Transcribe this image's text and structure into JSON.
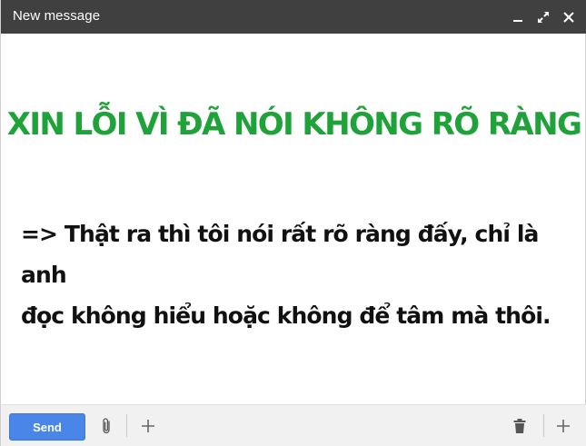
{
  "window": {
    "title": "New message"
  },
  "content": {
    "heading": "XIN LỖI VÌ ĐÃ NÓI KHÔNG RÕ RÀNG",
    "lines": [
      "=> Thật ra thì tôi nói rất rõ ràng đấy, chỉ là anh",
      "đọc không hiểu hoặc không để tâm mà thôi."
    ]
  },
  "toolbar": {
    "send_label": "Send"
  },
  "icons": {
    "minimize": "minimize-icon",
    "expand": "expand-icon",
    "close": "close-icon",
    "attach": "paperclip-icon",
    "more_left": "plus-icon",
    "delete": "trash-icon",
    "more_right": "plus-icon"
  },
  "colors": {
    "titlebar": "#404040",
    "heading": "#1fa23a",
    "send_button": "#4a86e8",
    "footer": "#f1f1f1"
  }
}
